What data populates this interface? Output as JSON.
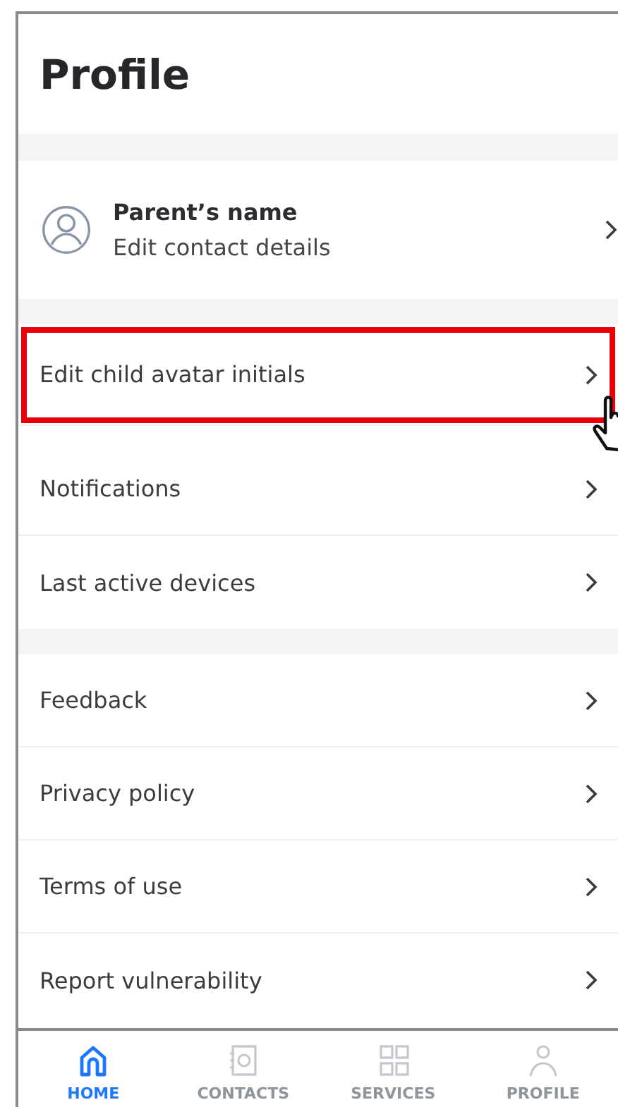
{
  "title": "Profile",
  "account": {
    "name": "Parent’s name",
    "subtitle": "Edit contact details"
  },
  "groups": [
    {
      "items": [
        {
          "label": "Edit child avatar initials",
          "highlighted": true
        },
        {
          "label": "Notifications",
          "highlighted": false
        },
        {
          "label": "Last active devices",
          "highlighted": false
        }
      ]
    },
    {
      "items": [
        {
          "label": "Feedback",
          "highlighted": false
        },
        {
          "label": "Privacy policy",
          "highlighted": false
        },
        {
          "label": "Terms of use",
          "highlighted": false
        },
        {
          "label": "Report vulnerability",
          "highlighted": false
        }
      ]
    }
  ],
  "nav": [
    {
      "kind": "home",
      "label": "HOME",
      "selected": true
    },
    {
      "kind": "contacts",
      "label": "CONTACTS",
      "selected": false
    },
    {
      "kind": "services",
      "label": "SERVICES",
      "selected": false
    },
    {
      "kind": "profile",
      "label": "PROFILE",
      "selected": false
    }
  ]
}
